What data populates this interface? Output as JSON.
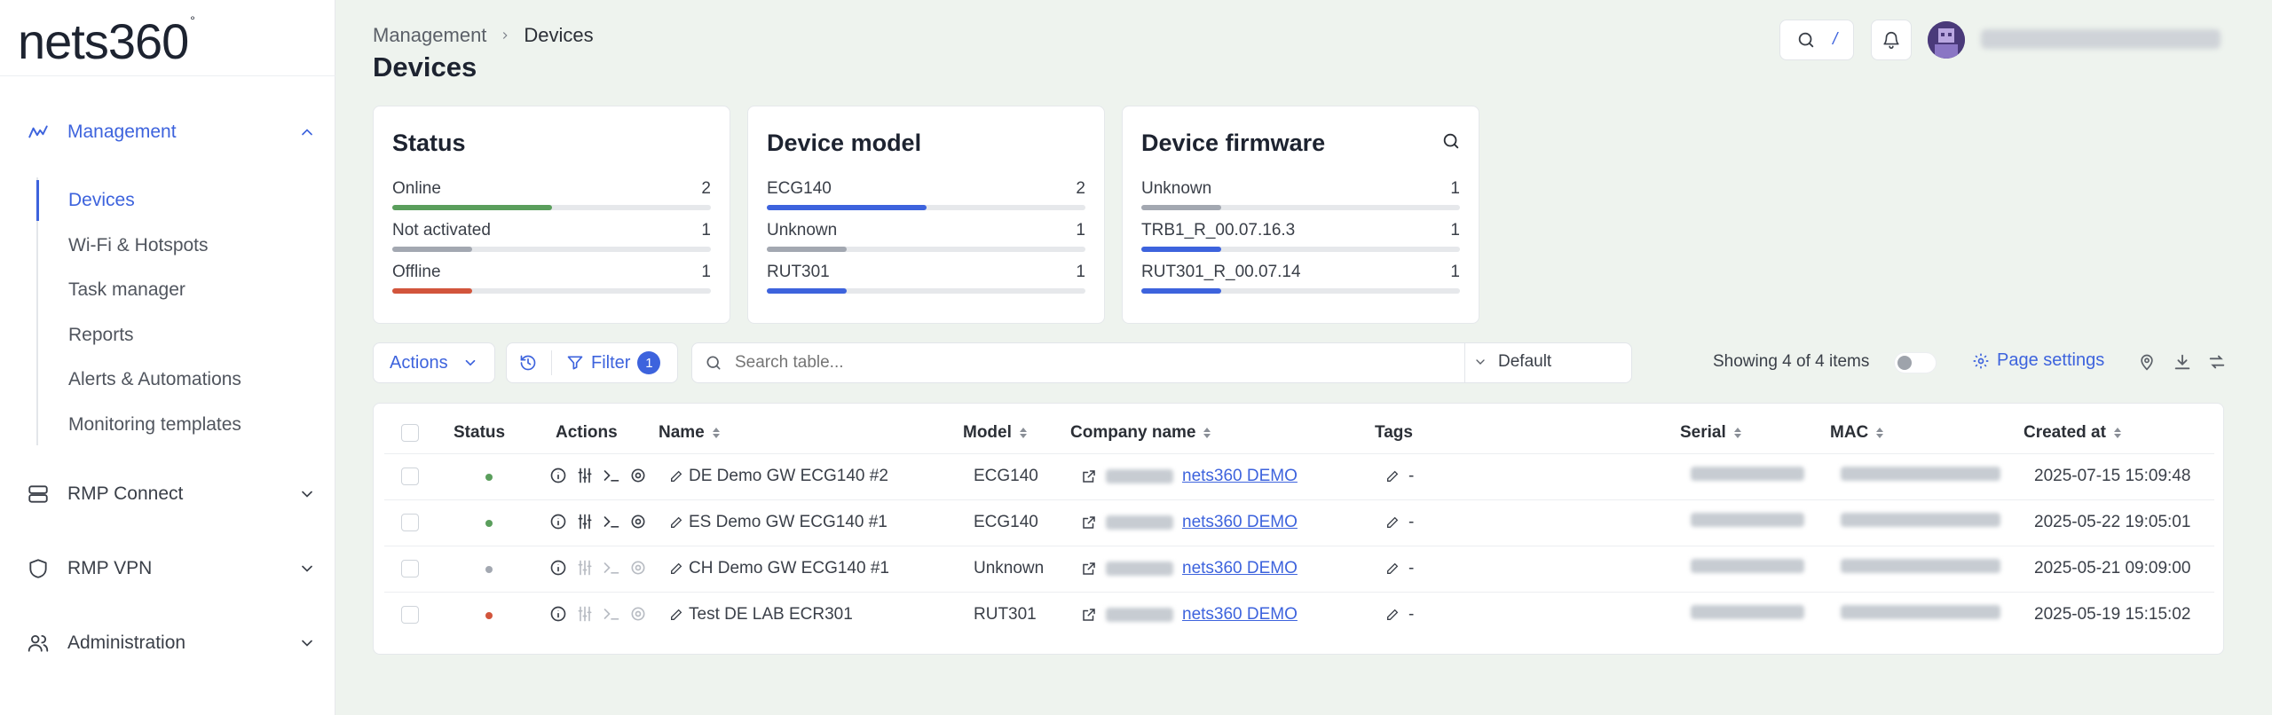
{
  "app": {
    "logo": "nets360",
    "logo_mark": "°"
  },
  "sidebar": {
    "sections": [
      {
        "label": "Management",
        "icon": "activity-icon",
        "expanded": true
      },
      {
        "label": "RMP Connect",
        "icon": "server-icon",
        "expanded": false
      },
      {
        "label": "RMP VPN",
        "icon": "shield-icon",
        "expanded": false
      },
      {
        "label": "Administration",
        "icon": "users-icon",
        "expanded": false
      }
    ],
    "management_items": [
      {
        "label": "Devices",
        "active": true
      },
      {
        "label": "Wi-Fi & Hotspots"
      },
      {
        "label": "Task manager"
      },
      {
        "label": "Reports"
      },
      {
        "label": "Alerts & Automations"
      },
      {
        "label": "Monitoring templates"
      }
    ]
  },
  "header": {
    "breadcrumb": [
      "Management",
      "Devices"
    ],
    "title": "Devices",
    "search_shortcut": "/"
  },
  "cards": {
    "status": {
      "title": "Status",
      "items": [
        {
          "label": "Online",
          "count": "2",
          "fraction": 0.5,
          "color": "#5a9e5c"
        },
        {
          "label": "Not activated",
          "count": "1",
          "fraction": 0.25,
          "color": "#a3a8b1"
        },
        {
          "label": "Offline",
          "count": "1",
          "fraction": 0.25,
          "color": "#d2553c"
        }
      ]
    },
    "model": {
      "title": "Device model",
      "items": [
        {
          "label": "ECG140",
          "count": "2",
          "fraction": 0.5,
          "color": "#3d63dd"
        },
        {
          "label": "Unknown",
          "count": "1",
          "fraction": 0.25,
          "color": "#a3a8b1"
        },
        {
          "label": "RUT301",
          "count": "1",
          "fraction": 0.25,
          "color": "#3d63dd"
        }
      ]
    },
    "firmware": {
      "title": "Device firmware",
      "items": [
        {
          "label": "Unknown",
          "count": "1",
          "fraction": 0.25,
          "color": "#a3a8b1"
        },
        {
          "label": "TRB1_R_00.07.16.3",
          "count": "1",
          "fraction": 0.25,
          "color": "#3d63dd"
        },
        {
          "label": "RUT301_R_00.07.14",
          "count": "1",
          "fraction": 0.25,
          "color": "#3d63dd"
        }
      ]
    }
  },
  "toolbar": {
    "actions_label": "Actions",
    "filter_label": "Filter",
    "filter_count": "1",
    "search_placeholder": "Search table...",
    "view_label": "Default",
    "showing_text": "Showing 4 of 4 items",
    "page_settings_label": "Page settings"
  },
  "table": {
    "headers": {
      "status": "Status",
      "actions": "Actions",
      "name": "Name",
      "model": "Model",
      "company": "Company name",
      "tags": "Tags",
      "serial": "Serial",
      "mac": "MAC",
      "created": "Created at"
    },
    "rows": [
      {
        "status_color": "#5a9e5c",
        "name": "DE Demo GW ECG140 #2",
        "model": "ECG140",
        "company": "nets360 DEMO",
        "tags": "-",
        "created": "2025-07-15 15:09:48",
        "actions_enabled": true
      },
      {
        "status_color": "#5a9e5c",
        "name": "ES Demo GW ECG140 #1",
        "model": "ECG140",
        "company": "nets360 DEMO",
        "tags": "-",
        "created": "2025-05-22 19:05:01",
        "actions_enabled": true
      },
      {
        "status_color": "#a3a8b1",
        "name": "CH Demo GW ECG140 #1",
        "model": "Unknown",
        "company": "nets360 DEMO",
        "tags": "-",
        "created": "2025-05-21 09:09:00",
        "actions_enabled": false
      },
      {
        "status_color": "#d2553c",
        "name": "Test DE LAB ECR301",
        "model": "RUT301",
        "company": "nets360 DEMO",
        "tags": "-",
        "created": "2025-05-19 15:15:02",
        "actions_enabled": false
      }
    ]
  },
  "colors": {
    "accent": "#3d63dd",
    "online": "#5a9e5c",
    "offline": "#d2553c",
    "inactive": "#a3a8b1"
  }
}
